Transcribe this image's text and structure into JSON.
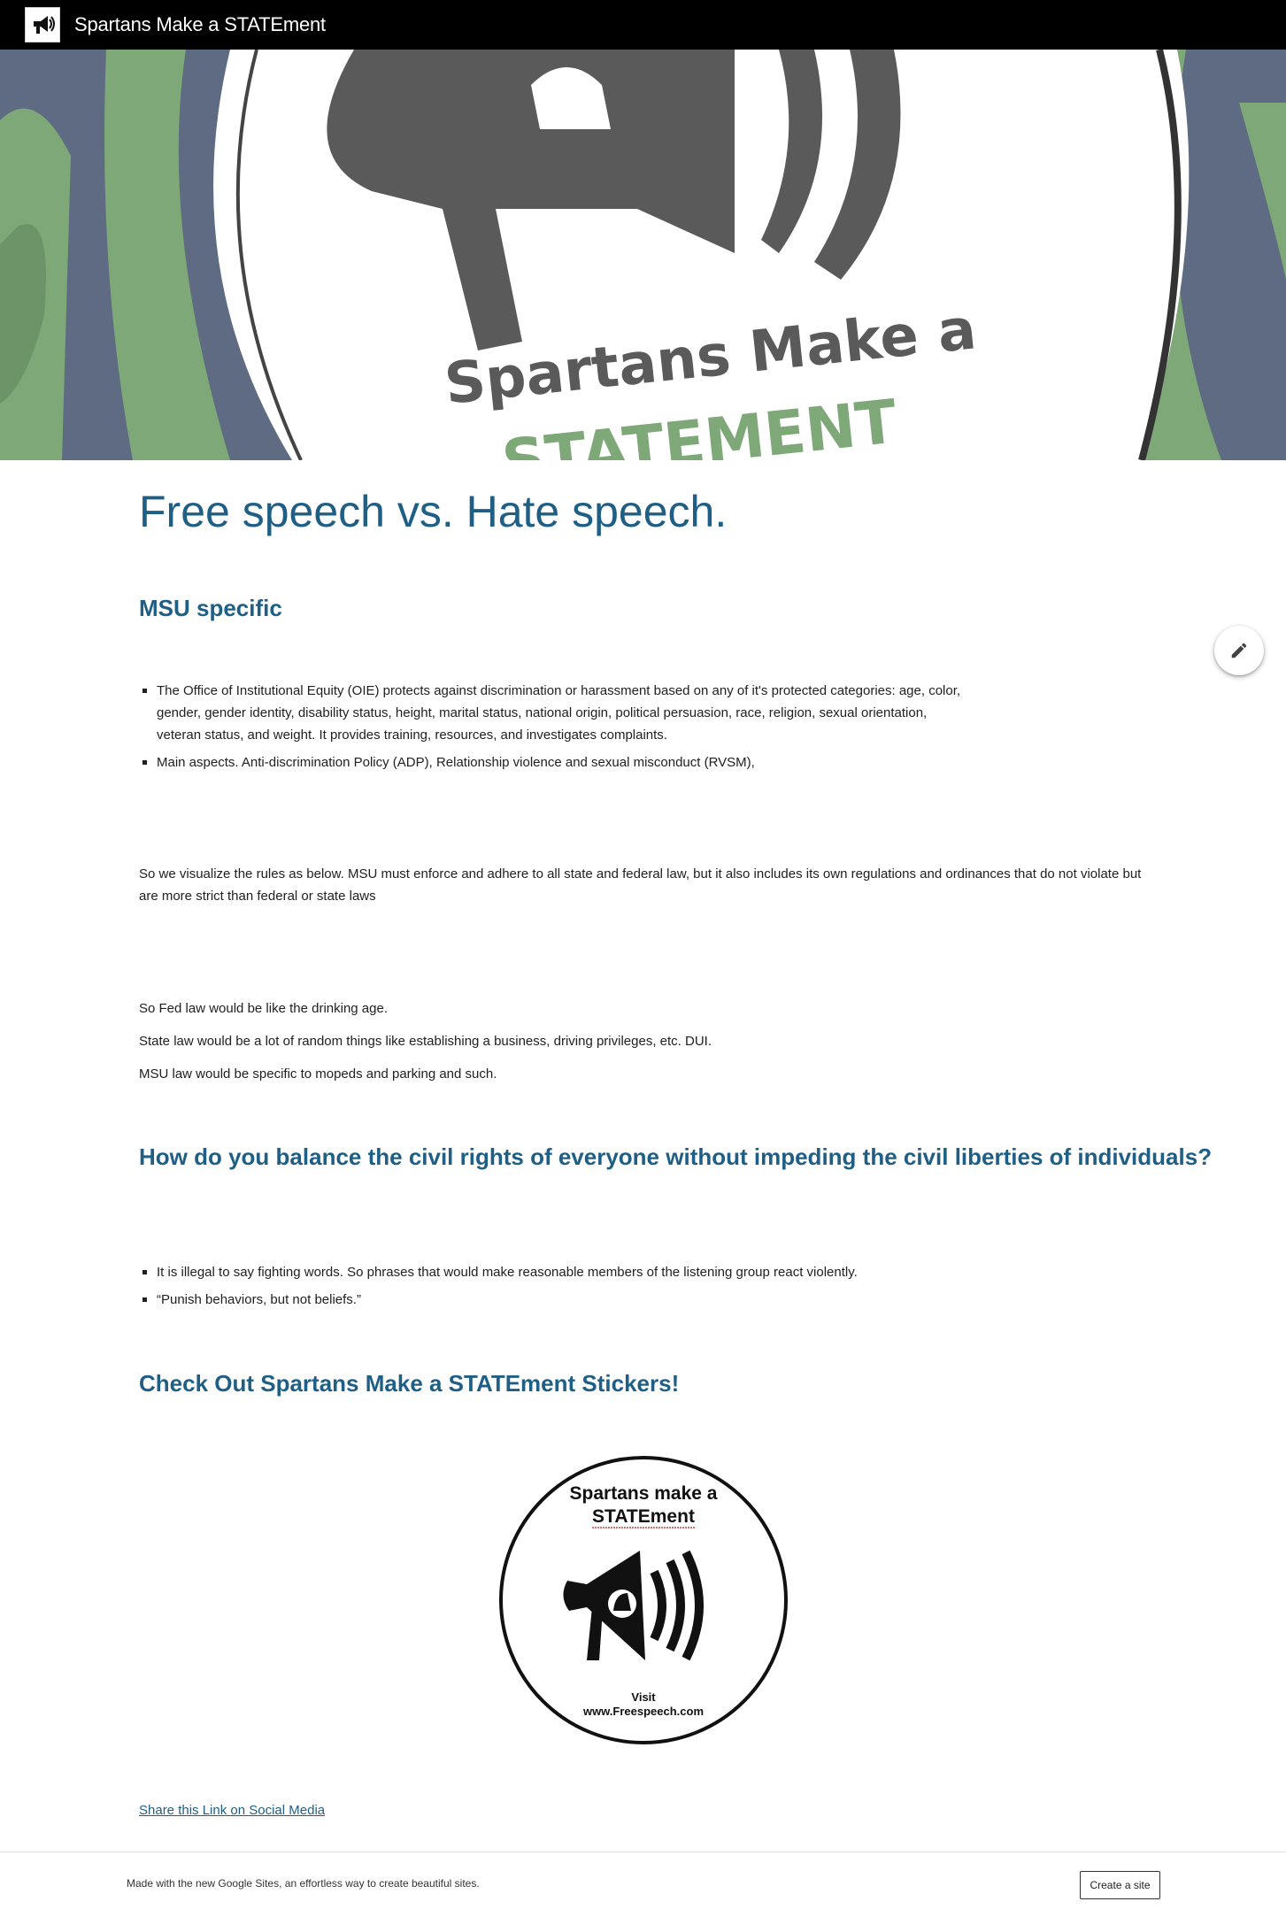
{
  "header": {
    "site_title": "Spartans Make a STATEment",
    "logo_icon": "megaphone-icon"
  },
  "hero": {
    "banner_text_line1": "Spartans Make a",
    "banner_text_line2": "STATEMENT",
    "colors": {
      "green": "#7ea877",
      "slate": "#5e6b82",
      "gray": "#5a5a5a"
    }
  },
  "main": {
    "page_title": "Free speech vs. Hate speech.",
    "section1": {
      "heading": "MSU specific",
      "bullets": [
        "The Office of Institutional Equity (OIE) protects against discrimination or harassment based on any of it's protected categories: age, color, gender, gender identity, disability status, height, marital status, national origin, political persuasion, race, religion, sexual orientation, veteran status, and weight. It provides training, resources, and investigates complaints.",
        "Main aspects. Anti-discrimination Policy (ADP), Relationship violence and sexual misconduct (RVSM),"
      ]
    },
    "paragraph1": "So we visualize the rules as below. MSU must enforce and adhere to all state and federal law, but it also includes its own regulations and ordinances that do not violate but are more strict than federal or state laws",
    "laws": [
      "So Fed law would be like the drinking age.",
      "State law would be a lot of random things like establishing a business, driving privileges, etc. DUI.",
      "MSU law would be specific to mopeds and parking and such."
    ],
    "section2": {
      "heading": "How do you balance the civil rights of everyone without impeding the civil liberties of individuals?",
      "bullets": [
        "It is illegal to say fighting words. So phrases that would make reasonable members of the listening group react violently.",
        "“Punish behaviors, but not beliefs.”"
      ]
    },
    "section3": {
      "heading": "Check Out Spartans Make a STATEment Stickers!"
    },
    "sticker": {
      "line1": "Spartans make a",
      "line2": "STATEment",
      "visit": "Visit",
      "url": "www.Freespeech.com"
    },
    "share_link": "Share this Link on Social Media"
  },
  "fab": {
    "icon": "pencil-icon"
  },
  "footer": {
    "text": "Made with the new Google Sites, an effortless way to create beautiful sites.",
    "create_button": "Create a site"
  }
}
